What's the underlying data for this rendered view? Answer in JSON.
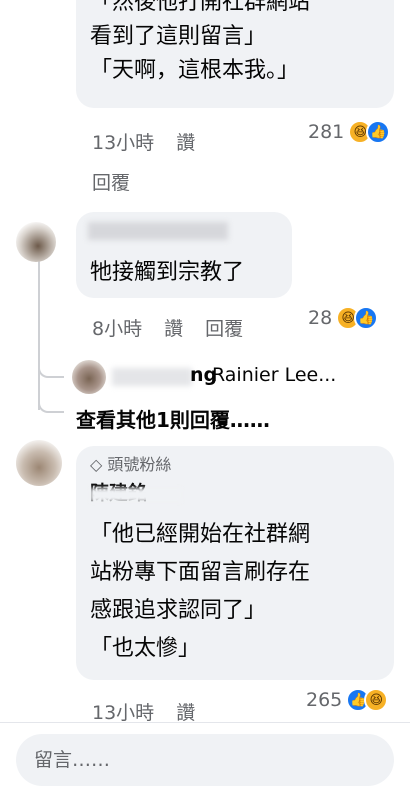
{
  "comment1": {
    "lines": [
      "「然後他打開社群網站",
      "看到了這則留言」",
      "「天啊，這根本我。」"
    ],
    "time": "13小時",
    "like": "讚",
    "reply": "回覆",
    "reaction_count": "281"
  },
  "reply1": {
    "text": "牠接觸到宗教了",
    "time": "8小時",
    "like": "讚",
    "reply": "回覆",
    "reaction_count": "28"
  },
  "reply2": {
    "author_tail": "Rainier Lee...",
    "author_partial": "ng"
  },
  "more_replies": "查看其他1則回覆……",
  "comment2": {
    "badge": "頭號粉絲",
    "author": "陳建銘",
    "lines": [
      "「他已經開始在社群網",
      "站粉專下面留言刷存在",
      "感跟追求認同了」",
      "「也太慘」"
    ],
    "time": "13小時",
    "like": "讚",
    "reaction_count": "265"
  },
  "input": {
    "placeholder": "留言……"
  },
  "icons": {
    "haha": "haha-reaction-icon",
    "like": "like-reaction-icon",
    "badge": "diamond-icon"
  }
}
